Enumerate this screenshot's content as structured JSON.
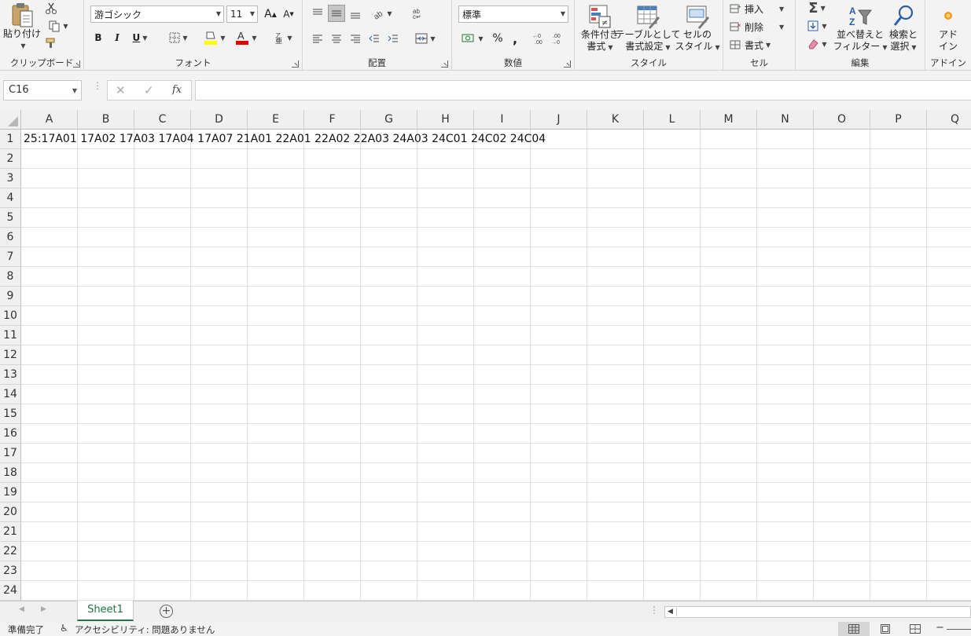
{
  "ribbon": {
    "clipboard": {
      "label": "クリップボード",
      "paste_label": "貼り付け"
    },
    "font": {
      "label": "フォント",
      "font_name": "游ゴシック",
      "font_size": "11",
      "bold": "B",
      "italic": "I",
      "underline": "U"
    },
    "alignment": {
      "label": "配置"
    },
    "number": {
      "label": "数値",
      "format": "標準",
      "percent": "%",
      "comma": ","
    },
    "styles": {
      "label": "スタイル",
      "conditional_line1": "条件付き",
      "conditional_line2": "書式",
      "table_line1": "テーブルとして",
      "table_line2": "書式設定",
      "cell_styles_line1": "セルの",
      "cell_styles_line2": "スタイル"
    },
    "cells": {
      "label": "セル",
      "insert": "挿入",
      "delete": "削除",
      "format": "書式"
    },
    "editing": {
      "label": "編集",
      "sort_line1": "並べ替えと",
      "sort_line2": "フィルター",
      "find_line1": "検索と",
      "find_line2": "選択"
    },
    "addins": {
      "label": "アドイン",
      "addin_line1": "アド",
      "addin_line2": "イン"
    }
  },
  "formula_bar": {
    "name_box": "C16",
    "fx": "fx",
    "cancel": "✕",
    "enter": "✓",
    "formula": ""
  },
  "grid": {
    "columns": [
      "A",
      "B",
      "C",
      "D",
      "E",
      "F",
      "G",
      "H",
      "I",
      "J",
      "K",
      "L",
      "M",
      "N",
      "O",
      "P",
      "Q"
    ],
    "rows": [
      "1",
      "2",
      "3",
      "4",
      "5",
      "6",
      "7",
      "8",
      "9",
      "10",
      "11",
      "12",
      "13",
      "14",
      "15",
      "16",
      "17",
      "18",
      "19",
      "20",
      "21",
      "22",
      "23",
      "24"
    ],
    "a1_value": "25:17A01 17A02 17A03 17A04 17A07 21A01 22A01 22A02 22A03 24A03 24C01 24C02 24C04"
  },
  "sheets": {
    "active_tab": "Sheet1",
    "add_sheet": "+"
  },
  "status": {
    "ready": "準備完了",
    "accessibility": "アクセシビリティ: 問題ありません"
  },
  "colors": {
    "accent": "#217346",
    "font_color": "#e00000",
    "highlight": "#ffff00"
  }
}
